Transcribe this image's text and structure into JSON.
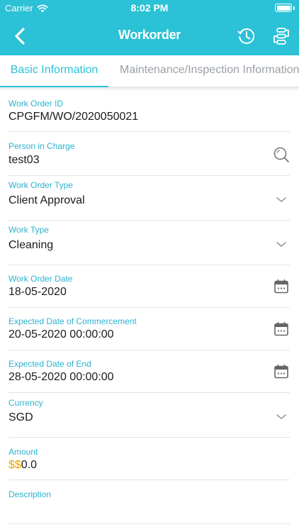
{
  "status_bar": {
    "carrier": "Carrier",
    "time": "8:02 PM"
  },
  "nav": {
    "title": "Workorder"
  },
  "tabs": [
    {
      "label": "Basic Information",
      "active": true
    },
    {
      "label": "Maintenance/Inspection Information",
      "active": false
    }
  ],
  "colors": {
    "primary": "#2bc1d6",
    "label": "#2bb3cf",
    "currency_symbol": "#f0a500"
  },
  "fields": {
    "work_order_id": {
      "label": "Work Order ID",
      "value": "CPGFM/WO/2020050021"
    },
    "person_in_charge": {
      "label": "Person in Charge",
      "value": "test03",
      "icon": "search-icon"
    },
    "work_order_type": {
      "label": "Work Order Type",
      "value": "Client Approval",
      "icon": "chevron-down-icon"
    },
    "work_type": {
      "label": "Work Type",
      "value": "Cleaning",
      "icon": "chevron-down-icon"
    },
    "work_order_date": {
      "label": "Work Order Date",
      "value": "18-05-2020",
      "icon": "calendar-icon"
    },
    "expected_commencement": {
      "label": "Expected Date of Commercement",
      "value": "20-05-2020 00:00:00",
      "icon": "calendar-icon"
    },
    "expected_end": {
      "label": "Expected Date of End",
      "value": "28-05-2020 00:00:00",
      "icon": "calendar-icon"
    },
    "currency": {
      "label": "Currency",
      "value": "SGD",
      "icon": "chevron-down-icon"
    },
    "amount": {
      "label": "Amount",
      "symbol": "$$",
      "value": "0.0"
    },
    "description": {
      "label": "Description",
      "value": ""
    }
  }
}
